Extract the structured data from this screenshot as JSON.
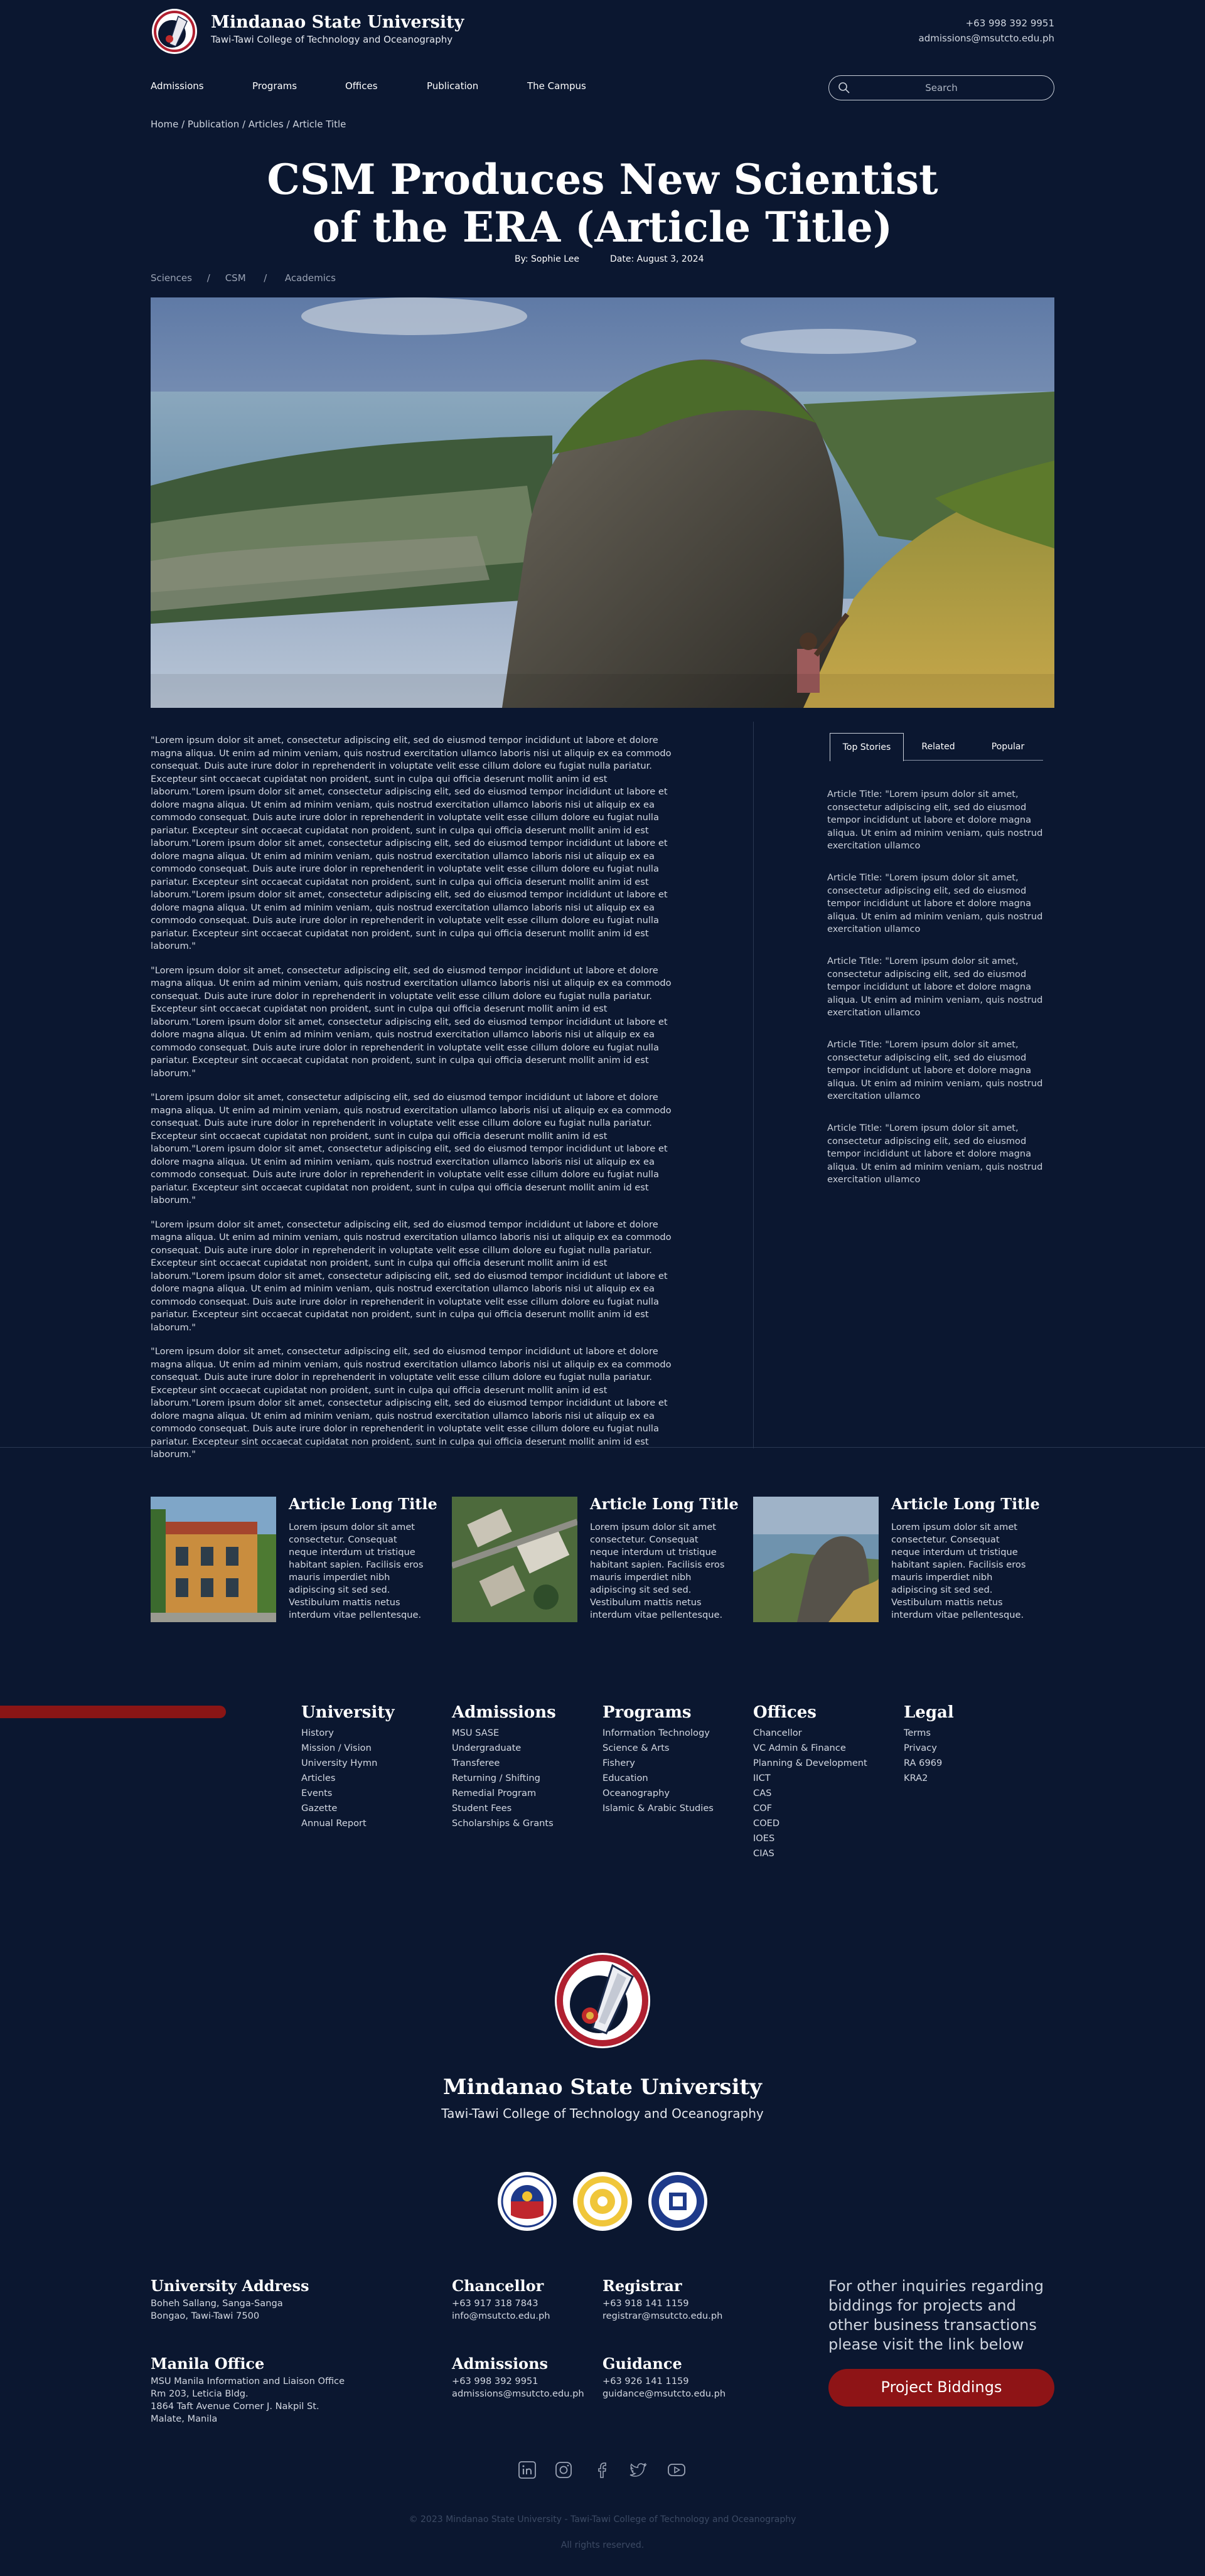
{
  "header": {
    "university": "Mindanao State University",
    "college": "Tawi-Tawi College of Technology and Oceanography",
    "phone": "+63 998 392 9951",
    "email": "admissions@msutcto.edu.ph"
  },
  "nav": {
    "items": [
      "Admissions",
      "Programs",
      "Offices",
      "Publication",
      "The Campus"
    ],
    "search_placeholder": "Search"
  },
  "breadcrumb": "Home  /  Publication  /  Articles  /  Article Title",
  "article": {
    "title_line1": "CSM Produces New Scientist",
    "title_line2": "of the ERA (Article Title)",
    "author": "By: Sophie Lee",
    "date": "Date: August 3, 2024",
    "tags": "Sciences     /     CSM      /      Academics",
    "paragraphs": [
      "\"Lorem ipsum dolor sit amet, consectetur adipiscing elit, sed do eiusmod tempor incididunt ut labore et dolore magna aliqua. Ut enim ad minim veniam, quis nostrud exercitation ullamco laboris nisi ut aliquip ex ea commodo consequat. Duis aute irure dolor in reprehenderit in voluptate velit esse cillum dolore eu fugiat nulla pariatur. Excepteur sint occaecat cupidatat non proident, sunt in culpa qui officia deserunt mollit anim id est laborum.\"Lorem ipsum dolor sit amet, consectetur adipiscing elit, sed do eiusmod tempor incididunt ut labore et dolore magna aliqua. Ut enim ad minim veniam, quis nostrud exercitation ullamco laboris nisi ut aliquip ex ea commodo consequat. Duis aute irure dolor in reprehenderit in voluptate velit esse cillum dolore eu fugiat nulla pariatur. Excepteur sint occaecat cupidatat non proident, sunt in culpa qui officia deserunt mollit anim id est laborum.\"Lorem ipsum dolor sit amet, consectetur adipiscing elit, sed do eiusmod tempor incididunt ut labore et dolore magna aliqua. Ut enim ad minim veniam, quis nostrud exercitation ullamco laboris nisi ut aliquip ex ea commodo consequat. Duis aute irure dolor in reprehenderit in voluptate velit esse cillum dolore eu fugiat nulla pariatur. Excepteur sint occaecat cupidatat non proident, sunt in culpa qui officia deserunt mollit anim id est laborum.\"Lorem ipsum dolor sit amet, consectetur adipiscing elit, sed do eiusmod tempor incididunt ut labore et dolore magna aliqua. Ut enim ad minim veniam, quis nostrud exercitation ullamco laboris nisi ut aliquip ex ea commodo consequat. Duis aute irure dolor in reprehenderit in voluptate velit esse cillum dolore eu fugiat nulla pariatur. Excepteur sint occaecat cupidatat non proident, sunt in culpa qui officia deserunt mollit anim id est laborum.\"",
      "\"Lorem ipsum dolor sit amet, consectetur adipiscing elit, sed do eiusmod tempor incididunt ut labore et dolore magna aliqua. Ut enim ad minim veniam, quis nostrud exercitation ullamco laboris nisi ut aliquip ex ea commodo consequat. Duis aute irure dolor in reprehenderit in voluptate velit esse cillum dolore eu fugiat nulla pariatur. Excepteur sint occaecat cupidatat non proident, sunt in culpa qui officia deserunt mollit anim id est laborum.\"Lorem ipsum dolor sit amet, consectetur adipiscing elit, sed do eiusmod tempor incididunt ut labore et dolore magna aliqua. Ut enim ad minim veniam, quis nostrud exercitation ullamco laboris nisi ut aliquip ex ea commodo consequat. Duis aute irure dolor in reprehenderit in voluptate velit esse cillum dolore eu fugiat nulla pariatur. Excepteur sint occaecat cupidatat non proident, sunt in culpa qui officia deserunt mollit anim id est laborum.\"",
      "\"Lorem ipsum dolor sit amet, consectetur adipiscing elit, sed do eiusmod tempor incididunt ut labore et dolore magna aliqua. Ut enim ad minim veniam, quis nostrud exercitation ullamco laboris nisi ut aliquip ex ea commodo consequat. Duis aute irure dolor in reprehenderit in voluptate velit esse cillum dolore eu fugiat nulla pariatur. Excepteur sint occaecat cupidatat non proident, sunt in culpa qui officia deserunt mollit anim id est laborum.\"Lorem ipsum dolor sit amet, consectetur adipiscing elit, sed do eiusmod tempor incididunt ut labore et dolore magna aliqua. Ut enim ad minim veniam, quis nostrud exercitation ullamco laboris nisi ut aliquip ex ea commodo consequat. Duis aute irure dolor in reprehenderit in voluptate velit esse cillum dolore eu fugiat nulla pariatur. Excepteur sint occaecat cupidatat non proident, sunt in culpa qui officia deserunt mollit anim id est laborum.\"",
      "\"Lorem ipsum dolor sit amet, consectetur adipiscing elit, sed do eiusmod tempor incididunt ut labore et dolore magna aliqua. Ut enim ad minim veniam, quis nostrud exercitation ullamco laboris nisi ut aliquip ex ea commodo consequat. Duis aute irure dolor in reprehenderit in voluptate velit esse cillum dolore eu fugiat nulla pariatur. Excepteur sint occaecat cupidatat non proident, sunt in culpa qui officia deserunt mollit anim id est laborum.\"Lorem ipsum dolor sit amet, consectetur adipiscing elit, sed do eiusmod tempor incididunt ut labore et dolore magna aliqua. Ut enim ad minim veniam, quis nostrud exercitation ullamco laboris nisi ut aliquip ex ea commodo consequat. Duis aute irure dolor in reprehenderit in voluptate velit esse cillum dolore eu fugiat nulla pariatur. Excepteur sint occaecat cupidatat non proident, sunt in culpa qui officia deserunt mollit anim id est laborum.\"",
      "\"Lorem ipsum dolor sit amet, consectetur adipiscing elit, sed do eiusmod tempor incididunt ut labore et dolore magna aliqua. Ut enim ad minim veniam, quis nostrud exercitation ullamco laboris nisi ut aliquip ex ea commodo consequat. Duis aute irure dolor in reprehenderit in voluptate velit esse cillum dolore eu fugiat nulla pariatur. Excepteur sint occaecat cupidatat non proident, sunt in culpa qui officia deserunt mollit anim id est laborum.\"Lorem ipsum dolor sit amet, consectetur adipiscing elit, sed do eiusmod tempor incididunt ut labore et dolore magna aliqua. Ut enim ad minim veniam, quis nostrud exercitation ullamco laboris nisi ut aliquip ex ea commodo consequat. Duis aute irure dolor in reprehenderit in voluptate velit esse cillum dolore eu fugiat nulla pariatur. Excepteur sint occaecat cupidatat non proident, sunt in culpa qui officia deserunt mollit anim id est laborum.\""
    ]
  },
  "sidebar": {
    "tabs": [
      "Top Stories",
      "Related",
      "Popular"
    ],
    "active_tab": "Top Stories",
    "items": [
      "Article Title: \"Lorem ipsum dolor sit amet, consectetur adipiscing elit, sed do eiusmod tempor incididunt ut labore et dolore magna aliqua. Ut enim ad minim veniam, quis nostrud exercitation ullamco",
      "Article Title: \"Lorem ipsum dolor sit amet, consectetur adipiscing elit, sed do eiusmod tempor incididunt ut labore et dolore magna aliqua. Ut enim ad minim veniam, quis nostrud exercitation ullamco",
      "Article Title: \"Lorem ipsum dolor sit amet, consectetur adipiscing elit, sed do eiusmod tempor incididunt ut labore et dolore magna aliqua. Ut enim ad minim veniam, quis nostrud exercitation ullamco",
      "Article Title: \"Lorem ipsum dolor sit amet, consectetur adipiscing elit, sed do eiusmod tempor incididunt ut labore et dolore magna aliqua. Ut enim ad minim veniam, quis nostrud exercitation ullamco",
      "Article Title: \"Lorem ipsum dolor sit amet, consectetur adipiscing elit, sed do eiusmod tempor incididunt ut labore et dolore magna aliqua. Ut enim ad minim veniam, quis nostrud exercitation ullamco"
    ]
  },
  "related_cards": [
    {
      "title": "Article Long Title",
      "text": "Lorem ipsum dolor sit amet consectetur. Consequat neque interdum ut tristique habitant sapien. Facilisis eros mauris imperdiet nibh adipiscing sit sed sed. Vestibulum mattis netus interdum vitae pellentesque."
    },
    {
      "title": "Article Long Title",
      "text": "Lorem ipsum dolor sit amet consectetur. Consequat neque interdum ut tristique habitant sapien. Facilisis eros mauris imperdiet nibh adipiscing sit sed sed. Vestibulum mattis netus interdum vitae pellentesque."
    },
    {
      "title": "Article Long Title",
      "text": "Lorem ipsum dolor sit amet consectetur. Consequat neque interdum ut tristique habitant sapien. Facilisis eros mauris imperdiet nibh adipiscing sit sed sed. Vestibulum mattis netus interdum vitae pellentesque."
    }
  ],
  "footer_links": {
    "university": {
      "title": "University",
      "items": [
        "History",
        "Mission / Vision",
        "University Hymn",
        "Articles",
        "Events",
        "Gazette",
        "Annual Report"
      ]
    },
    "admissions": {
      "title": "Admissions",
      "items": [
        "MSU SASE",
        "Undergraduate",
        "Transferee",
        "Returning / Shifting",
        "Remedial Program",
        "Student Fees",
        "Scholarships & Grants"
      ]
    },
    "programs": {
      "title": "Programs",
      "items": [
        "Information Technology",
        "Science & Arts",
        "Fishery",
        "Education",
        "Oceanography",
        "Islamic & Arabic Studies"
      ]
    },
    "offices": {
      "title": "Offices",
      "items": [
        "Chancellor",
        "VC Admin & Finance",
        "Planning & Development",
        "IICT",
        "CAS",
        "COF",
        "COED",
        "IOES",
        "CIAS"
      ]
    },
    "legal": {
      "title": "Legal",
      "items": [
        "Terms",
        "Privacy",
        "RA 6969",
        "KRA2"
      ]
    }
  },
  "footer_brand": {
    "university": "Mindanao State University",
    "college": "Tawi-Tawi College of Technology and Oceanography"
  },
  "contacts": {
    "address": {
      "title": "University Address",
      "lines": [
        "Boheh Sallang, Sanga-Sanga",
        "Bongao, Tawi-Tawi 7500"
      ]
    },
    "manila": {
      "title": "Manila Office",
      "lines": [
        "MSU Manila Information and Liaison Office",
        "Rm 203, Leticia Bldg.",
        "1864 Taft Avenue Corner J. Nakpil St.",
        "Malate, Manila"
      ]
    },
    "chancellor": {
      "title": "Chancellor",
      "phone": "+63 917 318 7843",
      "email": "info@msutcto.edu.ph"
    },
    "registrar": {
      "title": "Registrar",
      "phone": "+63 918 141 1159",
      "email": "registrar@msutcto.edu.ph"
    },
    "admissions": {
      "title": "Admissions",
      "phone": "+63 998 392 9951",
      "email": "admissions@msutcto.edu.ph"
    },
    "guidance": {
      "title": "Guidance",
      "phone": "+63 926 141 1159",
      "email": "guidance@msutcto.edu.ph"
    }
  },
  "inquiry": {
    "text": "For other inquiries regarding biddings for projects and other business transactions please visit the link below",
    "button": "Project Biddings"
  },
  "social_icons": [
    "linkedin-icon",
    "instagram-icon",
    "facebook-icon",
    "twitter-icon",
    "youtube-icon"
  ],
  "copyright": "© 2023 Mindanao State University - Tawi-Tawi College of Technology and Oceanography",
  "rights": "All rights reserved.",
  "colors": {
    "background": "#0b1730",
    "accent_red": "#8e1416",
    "text": "#e6e9ef"
  }
}
